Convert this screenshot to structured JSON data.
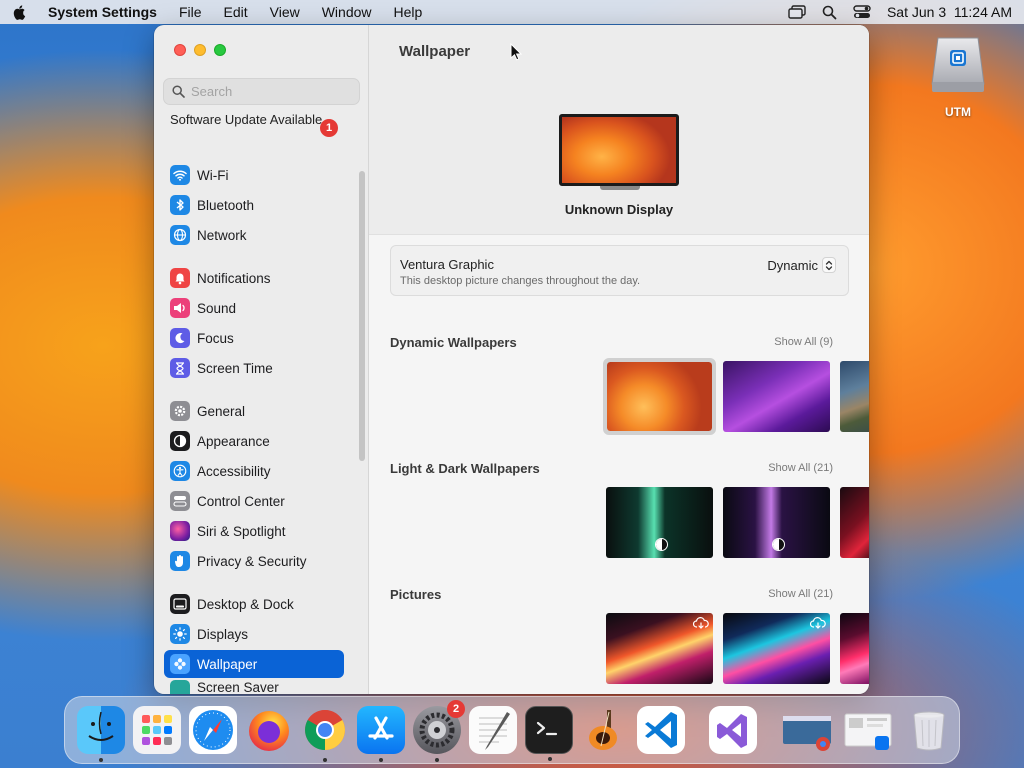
{
  "menubar": {
    "app_name": "System Settings",
    "menus": [
      "File",
      "Edit",
      "View",
      "Window",
      "Help"
    ],
    "datetime": "Sat Jun 3  11:24 AM"
  },
  "desktop": {
    "icon_label": "UTM"
  },
  "sidebar": {
    "search_placeholder": "Search",
    "update_label": "Software Update Available",
    "update_badge": "1",
    "items": [
      {
        "label": "Wi-Fi",
        "icon": "wifi-icon",
        "color": "#1e88e5"
      },
      {
        "label": "Bluetooth",
        "icon": "bluetooth-icon",
        "color": "#1e88e5"
      },
      {
        "label": "Network",
        "icon": "globe-icon",
        "color": "#1e88e5"
      },
      {
        "label": "Notifications",
        "icon": "bell-icon",
        "color": "#ef4444"
      },
      {
        "label": "Sound",
        "icon": "speaker-icon",
        "color": "#ec407a"
      },
      {
        "label": "Focus",
        "icon": "moon-icon",
        "color": "#5e5ce6"
      },
      {
        "label": "Screen Time",
        "icon": "hourglass-icon",
        "color": "#5e5ce6"
      },
      {
        "label": "General",
        "icon": "gear-icon",
        "color": "#8e8e93"
      },
      {
        "label": "Appearance",
        "icon": "appearance-icon",
        "color": "#1c1c1e"
      },
      {
        "label": "Accessibility",
        "icon": "accessibility-icon",
        "color": "#1e88e5"
      },
      {
        "label": "Control Center",
        "icon": "switches-icon",
        "color": "#8e8e93"
      },
      {
        "label": "Siri & Spotlight",
        "icon": "siri-icon",
        "color": "#7b1fa2"
      },
      {
        "label": "Privacy & Security",
        "icon": "hand-icon",
        "color": "#1e88e5"
      },
      {
        "label": "Desktop & Dock",
        "icon": "dock-icon",
        "color": "#1c1c1e"
      },
      {
        "label": "Displays",
        "icon": "sun-icon",
        "color": "#1e88e5"
      },
      {
        "label": "Wallpaper",
        "icon": "flower-icon",
        "color": "#4aa3ff"
      },
      {
        "label": "Screen Saver",
        "icon": "screensaver-icon",
        "color": "#26a69a"
      }
    ]
  },
  "content": {
    "title": "Wallpaper",
    "display_name": "Unknown Display",
    "current_wallpaper": {
      "name": "Ventura Graphic",
      "description": "This desktop picture changes throughout the day.",
      "mode": "Dynamic"
    },
    "sections": [
      {
        "title": "Dynamic Wallpapers",
        "show_all": "Show All (9)"
      },
      {
        "title": "Light & Dark Wallpapers",
        "show_all": "Show All (21)"
      },
      {
        "title": "Pictures",
        "show_all": "Show All (21)"
      }
    ]
  },
  "dock": {
    "settings_badge": "2",
    "apps": [
      "Finder",
      "Launchpad",
      "Safari",
      "Firefox",
      "Google Chrome",
      "App Store",
      "System Settings",
      "TextEdit",
      "Terminal",
      "GarageBand",
      "Visual Studio Code",
      "Visual Studio"
    ]
  }
}
